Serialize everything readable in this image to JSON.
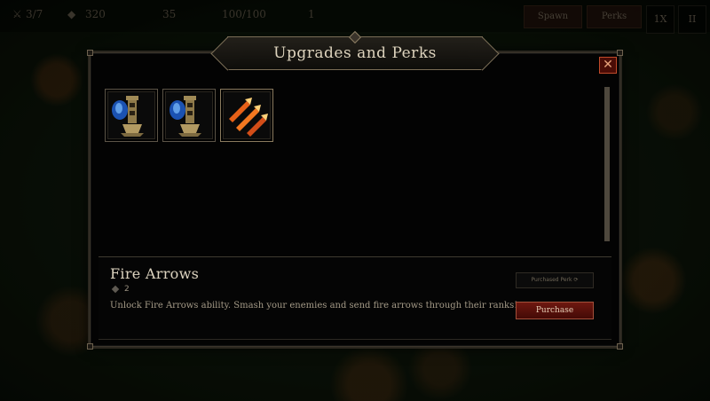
{
  "hud": {
    "wave": "3/7",
    "gold": "320",
    "lives": "35",
    "health": "100/100",
    "bonus": "1",
    "spawn_label": "Spawn",
    "perks_label": "Perks",
    "speed_label": "1X",
    "pause_label": "II"
  },
  "dialog": {
    "title": "Upgrades and Perks",
    "close_label": "✕"
  },
  "perks": [
    {
      "icon": "ice-tower-icon",
      "selected": false
    },
    {
      "icon": "ice-tower-icon",
      "selected": false
    },
    {
      "icon": "fire-arrows-icon",
      "selected": true
    }
  ],
  "selected_perk": {
    "name": "Fire Arrows",
    "cost": "2",
    "description": "Unlock Fire Arrows ability. Smash your enemies and send fire arrows through their ranks!",
    "purchased_label": "Purchased Perk  ⟳",
    "purchase_label": "Purchase"
  },
  "colors": {
    "accent": "#7a6d56",
    "purchase": "#6e1810",
    "close": "#c04a2a"
  }
}
